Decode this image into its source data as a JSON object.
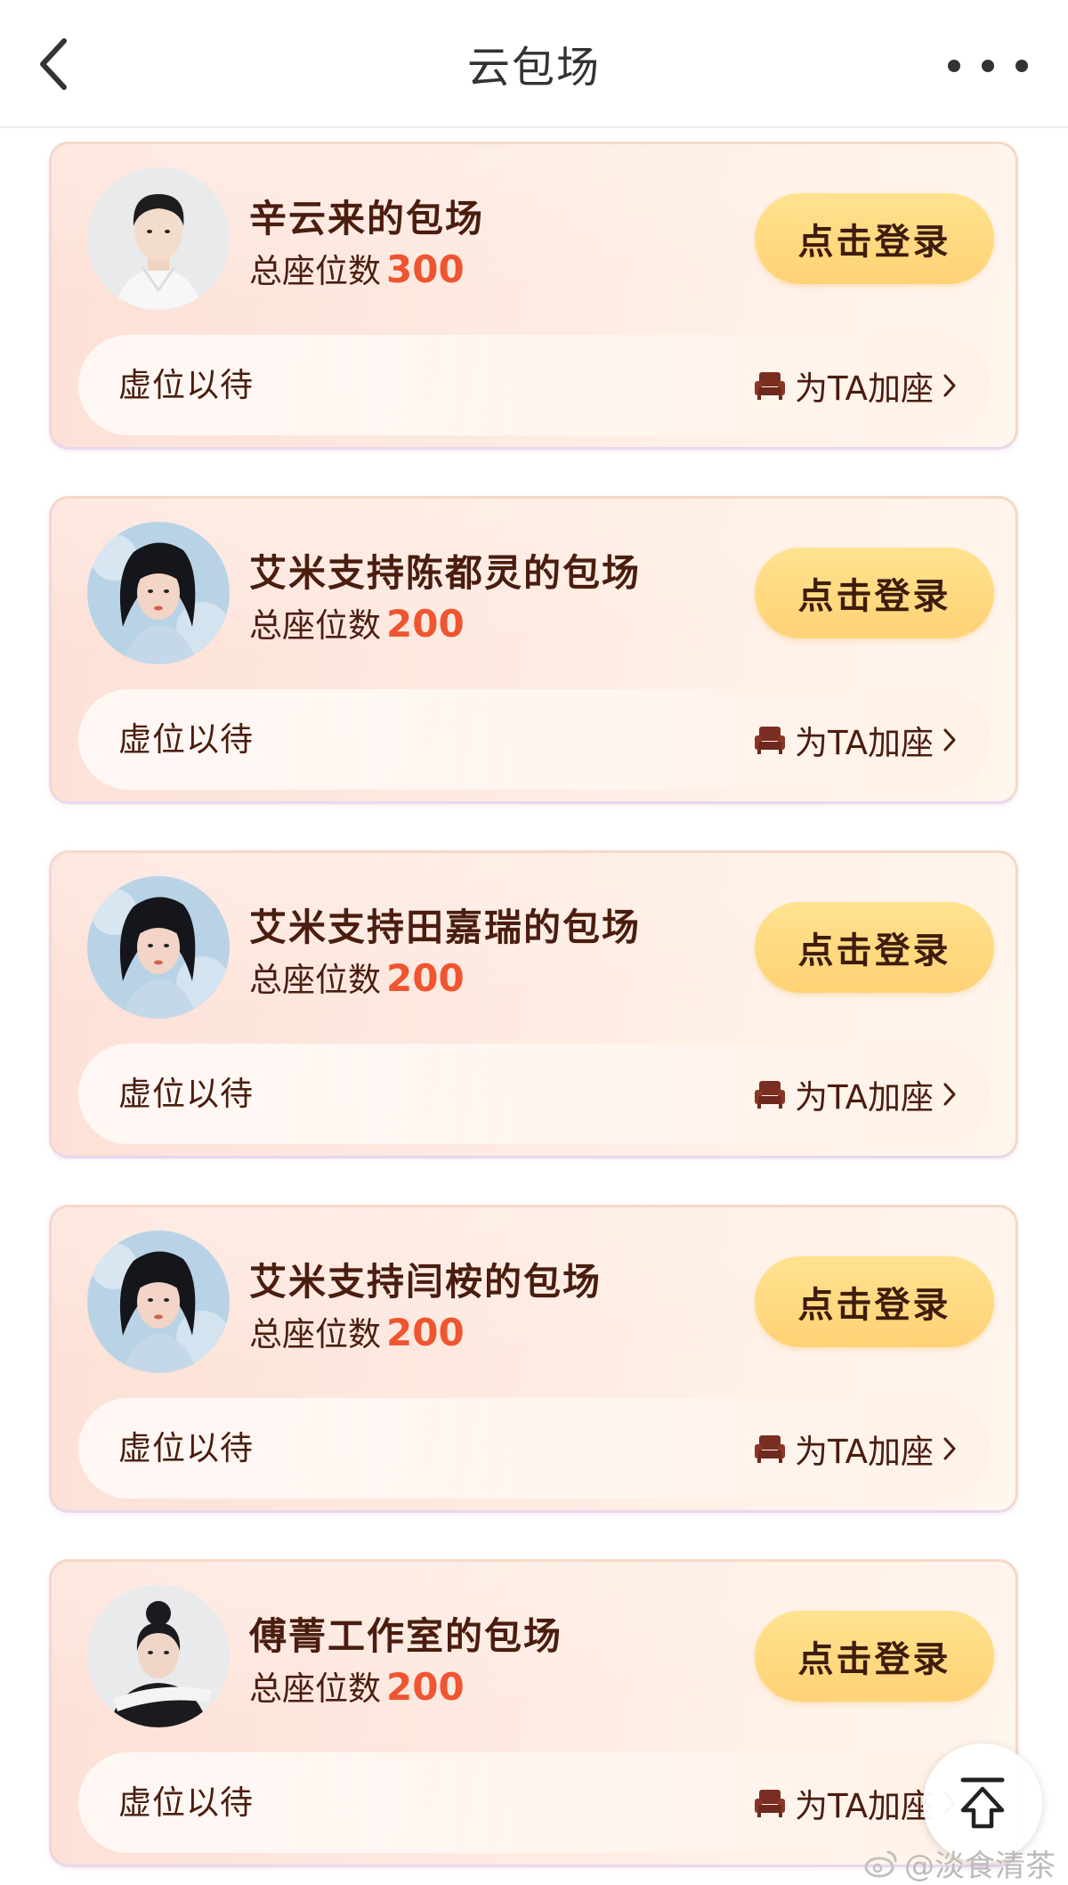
{
  "header": {
    "title": "云包场",
    "back_icon": "chevron-left-icon",
    "more_icon": "more-horizontal-icon"
  },
  "cards": [
    {
      "name": "辛云来的包场",
      "seats_label": "总座位数",
      "seats_value": "300",
      "login_label": "点击登录",
      "wait_label": "虚位以待",
      "add_seat_label": "为TA加座",
      "avatar": "man-portrait"
    },
    {
      "name": "艾米支持陈都灵的包场",
      "seats_label": "总座位数",
      "seats_value": "200",
      "login_label": "点击登录",
      "wait_label": "虚位以待",
      "add_seat_label": "为TA加座",
      "avatar": "woman-portrait"
    },
    {
      "name": "艾米支持田嘉瑞的包场",
      "seats_label": "总座位数",
      "seats_value": "200",
      "login_label": "点击登录",
      "wait_label": "虚位以待",
      "add_seat_label": "为TA加座",
      "avatar": "woman-portrait"
    },
    {
      "name": "艾米支持闫桉的包场",
      "seats_label": "总座位数",
      "seats_value": "200",
      "login_label": "点击登录",
      "wait_label": "虚位以待",
      "add_seat_label": "为TA加座",
      "avatar": "woman-portrait"
    },
    {
      "name": "傅菁工作室的包场",
      "seats_label": "总座位数",
      "seats_value": "200",
      "login_label": "点击登录",
      "wait_label": "虚位以待",
      "add_seat_label": "为TA加座",
      "avatar": "woman-bun-portrait"
    }
  ],
  "scroll_top_icon": "arrow-up-to-top-icon",
  "watermark": "@淡食清茶",
  "colors": {
    "accent": "#ef5530",
    "button": "#ffd678",
    "text_dark": "#4a1d0f"
  }
}
